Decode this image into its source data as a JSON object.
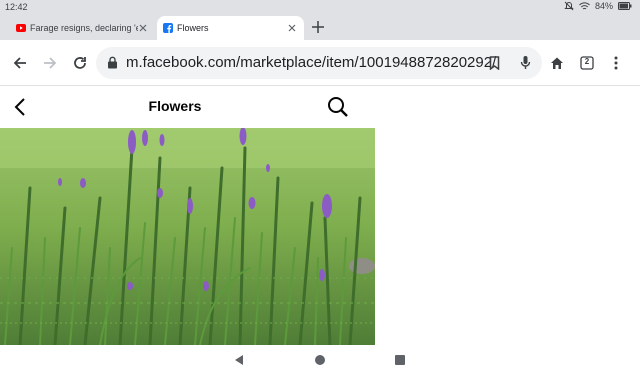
{
  "status_bar": {
    "time": "12:42",
    "battery": "84%"
  },
  "tabs": [
    {
      "title": "Farage resigns, declaring 'en",
      "favicon": "youtube-icon",
      "active": false
    },
    {
      "title": "Flowers",
      "favicon": "facebook-icon",
      "active": true
    }
  ],
  "toolbar": {
    "url": "m.facebook.com/marketplace/item/1001948872820292/",
    "tab_count": "2"
  },
  "page": {
    "title": "Flowers"
  },
  "colors": {
    "facebook_blue": "#1877f2",
    "youtube_red": "#ff0000",
    "chrome_gray": "#dfe1e5"
  }
}
